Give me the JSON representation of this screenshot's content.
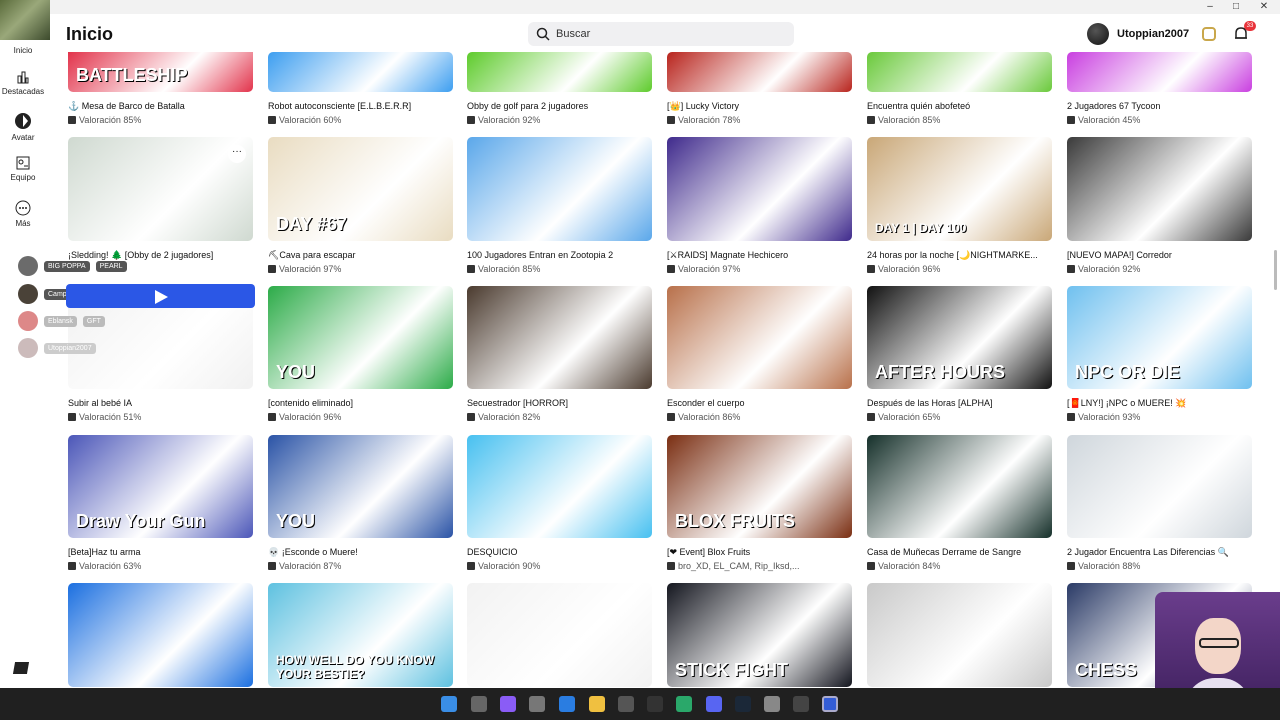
{
  "window": {
    "minimize": "–",
    "maximize": "□",
    "close": "✕"
  },
  "header": {
    "title": "Inicio",
    "search_placeholder": "Buscar",
    "username": "Utoppian2007",
    "notif_count": "33"
  },
  "sidebar": {
    "items": [
      {
        "label": "Inicio",
        "icon": "home-icon"
      },
      {
        "label": "Destacadas",
        "icon": "chart-icon"
      },
      {
        "label": "Avatar",
        "icon": "avatar-icon"
      },
      {
        "label": "Equipo",
        "icon": "team-icon"
      },
      {
        "label": "Más",
        "icon": "more-icon"
      }
    ]
  },
  "friends": [
    {
      "name": "BIG POPPA",
      "extra": "PEARL"
    },
    {
      "name": "Campesino"
    },
    {
      "name": "Eblansk",
      "extra": "GFT"
    },
    {
      "name": "Utoppian2007"
    }
  ],
  "rows": [
    [
      {
        "title": "⚓ Mesa de Barco de Batalla",
        "rating": "Valoración 85%",
        "img_text": "BATTLESHIP"
      },
      {
        "title": "Robot autoconsciente [E.L.B.E.R.R]",
        "rating": "Valoración 60%"
      },
      {
        "title": "Obby de golf para 2 jugadores",
        "rating": "Valoración 92%"
      },
      {
        "title": "[👑] Lucky Victory",
        "rating": "Valoración 78%"
      },
      {
        "title": "Encuentra quién abofeteó",
        "rating": "Valoración 85%"
      },
      {
        "title": "2 Jugadores 67 Tycoon",
        "rating": "Valoración 45%"
      }
    ],
    [
      {
        "title": "¡Sledding! 🌲 [Obby de 2 jugadores]",
        "rating": ""
      },
      {
        "title": "⛏Cava para escapar",
        "rating": "Valoración 97%",
        "img_text": "DAY #67"
      },
      {
        "title": "100 Jugadores Entran en Zootopia 2",
        "rating": "Valoración 85%"
      },
      {
        "title": "[⚔RAIDS] Magnate Hechicero",
        "rating": "Valoración 97%"
      },
      {
        "title": "24 horas por la noche [🌙NIGHTMARKE...",
        "rating": "Valoración 96%",
        "img_text": "DAY 1 | DAY 100"
      },
      {
        "title": "[NUEVO MAPA!] Corredor",
        "rating": "Valoración 92%"
      }
    ],
    [
      {
        "title": "Subir al bebé IA",
        "rating": "Valoración 51%"
      },
      {
        "title": "[contenido eliminado]",
        "rating": "Valoración 96%",
        "img_text": "YOU"
      },
      {
        "title": "Secuestrador [HORROR]",
        "rating": "Valoración 82%"
      },
      {
        "title": "Esconder el cuerpo",
        "rating": "Valoración 86%"
      },
      {
        "title": "Después de las Horas [ALPHA]",
        "rating": "Valoración 65%",
        "img_text": "AFTER HOURS"
      },
      {
        "title": "[🧧LNY!] ¡NPC o MUERE! 💥",
        "rating": "Valoración 93%",
        "img_text": "NPC OR DIE"
      }
    ],
    [
      {
        "title": "[Beta]Haz tu arma",
        "rating": "Valoración 63%",
        "img_text": "Draw Your Gun"
      },
      {
        "title": "💀 ¡Esconde o Muere!",
        "rating": "Valoración 87%",
        "img_text": "YOU"
      },
      {
        "title": "DESQUICIO",
        "rating": "Valoración 90%"
      },
      {
        "title": "[❤ Event] Blox Fruits",
        "rating": "bro_XD, EL_CAM, Rip_Iksd,...",
        "img_text": "BLOX FRUITS"
      },
      {
        "title": "Casa de Muñecas Derrame de Sangre",
        "rating": "Valoración 84%"
      },
      {
        "title": "2 Jugador Encuentra Las Diferencias 🔍",
        "rating": "Valoración 88%"
      }
    ],
    [
      {
        "img_text": ""
      },
      {
        "img_text": "HOW WELL DO YOU KNOW YOUR BESTIE?"
      },
      {
        "img_text": ""
      },
      {
        "img_text": "STICK FIGHT"
      },
      {
        "img_text": ""
      },
      {
        "img_text": "CHESS"
      }
    ]
  ],
  "colors": {
    "play": "#2b57e6",
    "accent": "#e8333a"
  }
}
